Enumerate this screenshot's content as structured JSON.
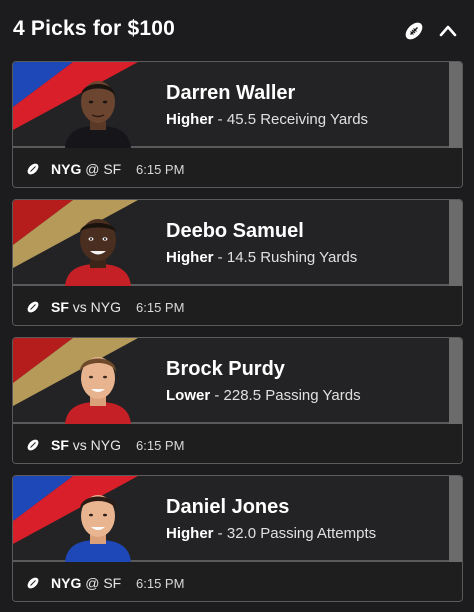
{
  "header": {
    "title": "4 Picks for $100"
  },
  "picks": [
    {
      "player": "Darren Waller",
      "direction": "Higher",
      "separator": " - ",
      "line": "45.5 Receiving Yards",
      "team1": "NYG",
      "conn": " @ ",
      "team2": "SF",
      "time": "6:15 PM",
      "colors": {
        "stripe1": "#1e48b8",
        "stripe2": "#d81f2a"
      }
    },
    {
      "player": "Deebo Samuel",
      "direction": "Higher",
      "separator": " - ",
      "line": "14.5 Rushing Yards",
      "team1": "SF",
      "conn": " vs ",
      "team2": "NYG",
      "time": "6:15 PM",
      "colors": {
        "stripe1": "#b51d1d",
        "stripe2": "#b59a5a"
      }
    },
    {
      "player": "Brock Purdy",
      "direction": "Lower",
      "separator": " - ",
      "line": "228.5 Passing Yards",
      "team1": "SF",
      "conn": " vs ",
      "team2": "NYG",
      "time": "6:15 PM",
      "colors": {
        "stripe1": "#b51d1d",
        "stripe2": "#b59a5a"
      }
    },
    {
      "player": "Daniel Jones",
      "direction": "Higher",
      "separator": " - ",
      "line": "32.0 Passing Attempts",
      "team1": "NYG",
      "conn": " @ ",
      "team2": "SF",
      "time": "6:15 PM",
      "colors": {
        "stripe1": "#1e48b8",
        "stripe2": "#d81f2a"
      }
    }
  ]
}
